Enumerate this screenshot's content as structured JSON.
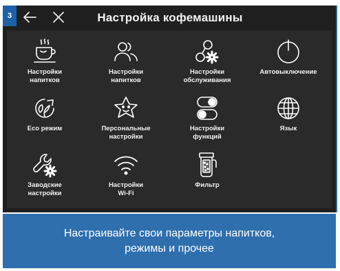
{
  "step_badge": "3",
  "header": {
    "title": "Настройка кофемашины",
    "back_icon": "arrow-left-icon",
    "close_icon": "close-icon"
  },
  "tiles": [
    {
      "label": "Настройки\nнапитков",
      "icon": "coffee-cup-icon"
    },
    {
      "label": "Настройки\nнапитков",
      "icon": "users-icon"
    },
    {
      "label": "Настройки\nобслуживания",
      "icon": "service-gear-icon"
    },
    {
      "label": "Автовыключение",
      "icon": "power-icon"
    },
    {
      "label": "Eco режим",
      "icon": "eco-leaf-icon"
    },
    {
      "label": "Персональные\nнастройки",
      "icon": "smiley-star-icon"
    },
    {
      "label": "Настройки\nфункций",
      "icon": "toggle-switches-icon"
    },
    {
      "label": "Язык",
      "icon": "globe-icon"
    },
    {
      "label": "Заводские\nнастройки",
      "icon": "wrench-gear-icon"
    },
    {
      "label": "Настройки\nWi-Fi",
      "icon": "wifi-icon"
    },
    {
      "label": "Фильтр",
      "icon": "water-filter-icon"
    }
  ],
  "caption": "Настраивайте свои параметры напитков,\nрежимы и прочее",
  "colors": {
    "screen_bg": "#1f1f1f",
    "panel_bg": "#2a2a2a",
    "accent_blue": "#2f6fae",
    "badge_blue": "#1d62a8",
    "icon_stroke": "#ffffff",
    "text": "#f2f2f2"
  }
}
